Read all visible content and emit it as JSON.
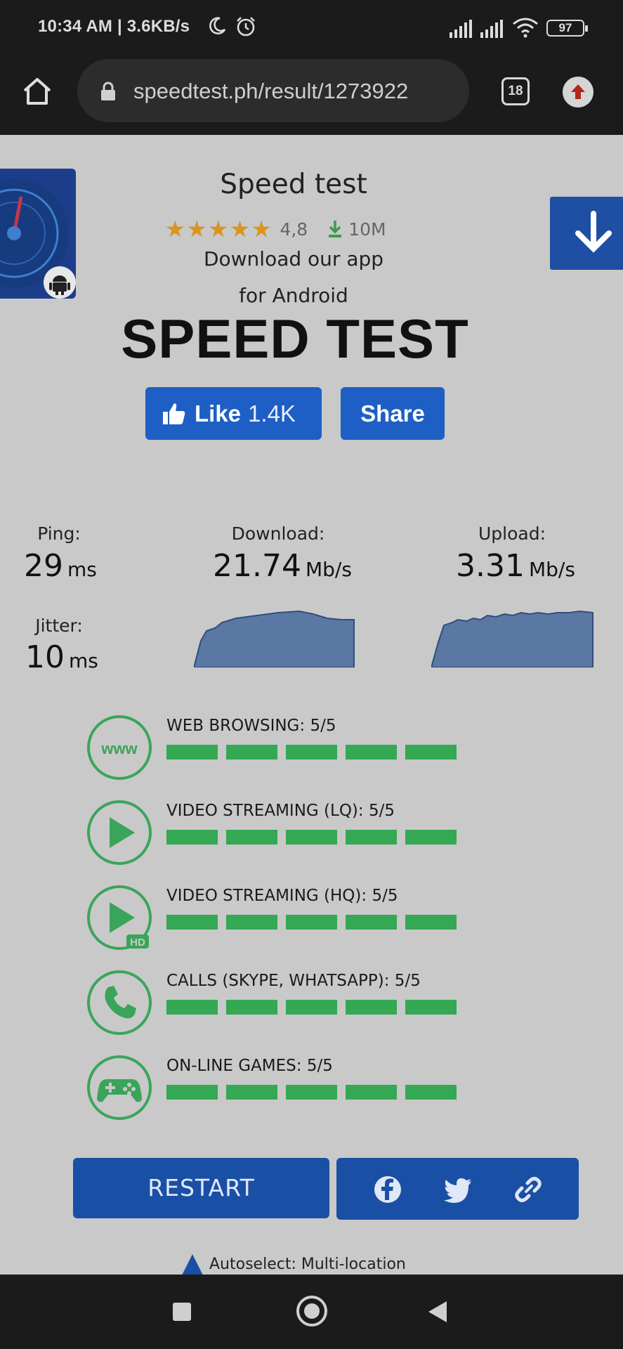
{
  "status_bar": {
    "time": "10:34 AM | 3.6KB/s",
    "battery": "97",
    "icons": [
      "moon-icon",
      "alarm-icon",
      "signal-icon",
      "signal-icon",
      "wifi-icon",
      "battery-icon"
    ]
  },
  "browser": {
    "url": "speedtest.ph/result/1273922",
    "tab_count": "18"
  },
  "app_banner": {
    "title": "Speed test",
    "rating": "4,8",
    "stars": "★★★★★",
    "star_count": 4.8,
    "downloads": "10M",
    "line1": "Download our app",
    "line2": "for Android"
  },
  "page": {
    "title": "SPEED TEST",
    "like_label": "Like",
    "like_count": "1.4K",
    "share_label": "Share"
  },
  "results": {
    "ping_label": "Ping:",
    "ping_value": "29",
    "ping_unit": "ms",
    "download_label": "Download:",
    "download_value": "21.74",
    "download_unit": "Mb/s",
    "upload_label": "Upload:",
    "upload_value": "3.31",
    "upload_unit": "Mb/s",
    "jitter_label": "Jitter:",
    "jitter_value": "10",
    "jitter_unit": "ms"
  },
  "quality": [
    {
      "label": "WEB BROWSING: 5/5",
      "score": 5,
      "max": 5,
      "icon": "www-icon"
    },
    {
      "label": "VIDEO STREAMING (LQ): 5/5",
      "score": 5,
      "max": 5,
      "icon": "play-icon"
    },
    {
      "label": "VIDEO STREAMING (HQ): 5/5",
      "score": 5,
      "max": 5,
      "icon": "play-hd-icon"
    },
    {
      "label": "CALLS (SKYPE, WHATSAPP): 5/5",
      "score": 5,
      "max": 5,
      "icon": "phone-icon"
    },
    {
      "label": "ON-LINE GAMES: 5/5",
      "score": 5,
      "max": 5,
      "icon": "gamepad-icon"
    }
  ],
  "actions": {
    "restart_label": "RESTART",
    "share_icons": [
      "facebook-icon",
      "twitter-icon",
      "link-icon"
    ]
  },
  "server": {
    "autoselect_text": "Autoselect: Multi-location"
  },
  "colors": {
    "accent_blue": "#1a4fa6",
    "like_blue": "#1d5fc4",
    "quality_green": "#34a853",
    "graph_fill": "#5a78a3",
    "star_gold": "#d9951e"
  }
}
